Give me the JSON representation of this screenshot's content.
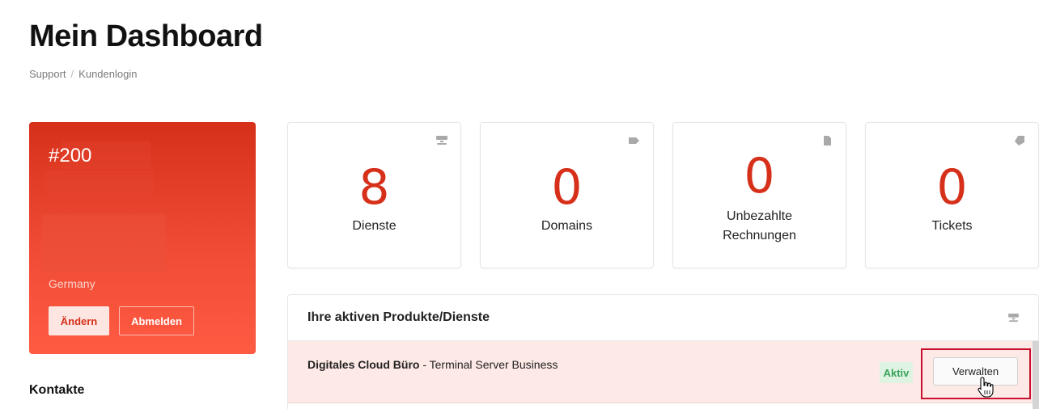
{
  "page": {
    "title": "Mein Dashboard",
    "breadcrumb": {
      "items": [
        "Support",
        "Kundenlogin"
      ],
      "separator": "/"
    }
  },
  "profile": {
    "client_id": "#200",
    "country": "Germany",
    "edit_label": "Ändern",
    "logout_label": "Abmelden",
    "gradient_from": "#d6301a",
    "gradient_to": "#ff5a42"
  },
  "contacts": {
    "heading": "Kontakte"
  },
  "stats": [
    {
      "value": "8",
      "label": "Dienste",
      "icon": "server-icon"
    },
    {
      "value": "0",
      "label": "Domains",
      "icon": "tag-icon"
    },
    {
      "value": "0",
      "label": "Unbezahlte Rechnungen",
      "icon": "document-icon"
    },
    {
      "value": "0",
      "label": "Tickets",
      "icon": "ticket-icon"
    }
  ],
  "products": {
    "title": "Ihre aktiven Produkte/Dienste",
    "rows": [
      {
        "name": "Digitales Cloud Büro",
        "plan": " - Terminal Server Business",
        "status": "Aktiv",
        "action_label": "Verwalten"
      }
    ]
  },
  "colors": {
    "accent": "#d6301a",
    "active_green": "#3aa35a",
    "row_highlight": "#fde9e5"
  }
}
